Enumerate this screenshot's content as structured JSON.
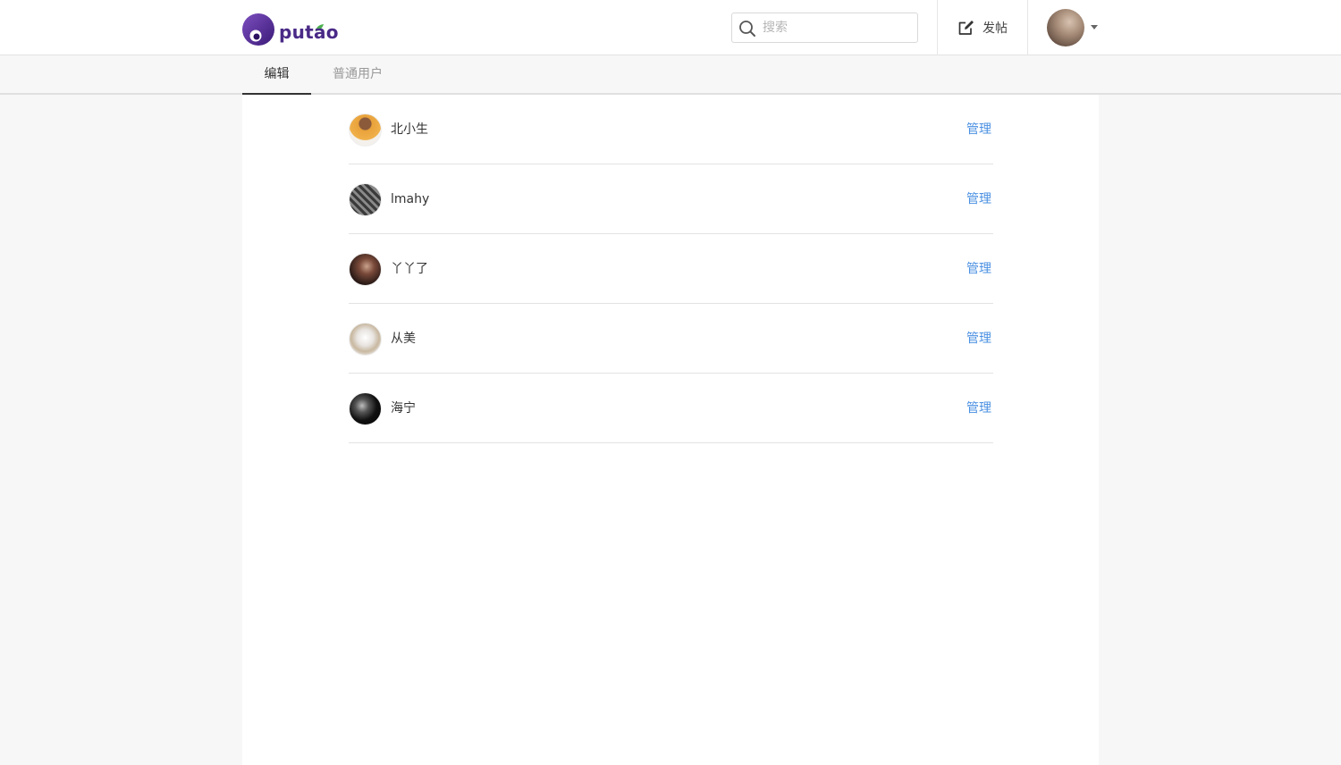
{
  "header": {
    "logo_text": "putao",
    "search": {
      "placeholder": "搜索",
      "value": ""
    },
    "post_button_label": "发帖"
  },
  "tabs": [
    {
      "label": "编辑",
      "active": true
    },
    {
      "label": "普通用户",
      "active": false
    }
  ],
  "users": [
    {
      "name": "北小生",
      "action": "管理"
    },
    {
      "name": "lmahy",
      "action": "管理"
    },
    {
      "name": "丫丫了",
      "action": "管理"
    },
    {
      "name": "从美",
      "action": "管理"
    },
    {
      "name": "海宁",
      "action": "管理"
    }
  ],
  "colors": {
    "brand": "#4a2a87",
    "link": "#4a90e2",
    "active_tab": "#333333",
    "inactive_tab": "#999999"
  }
}
